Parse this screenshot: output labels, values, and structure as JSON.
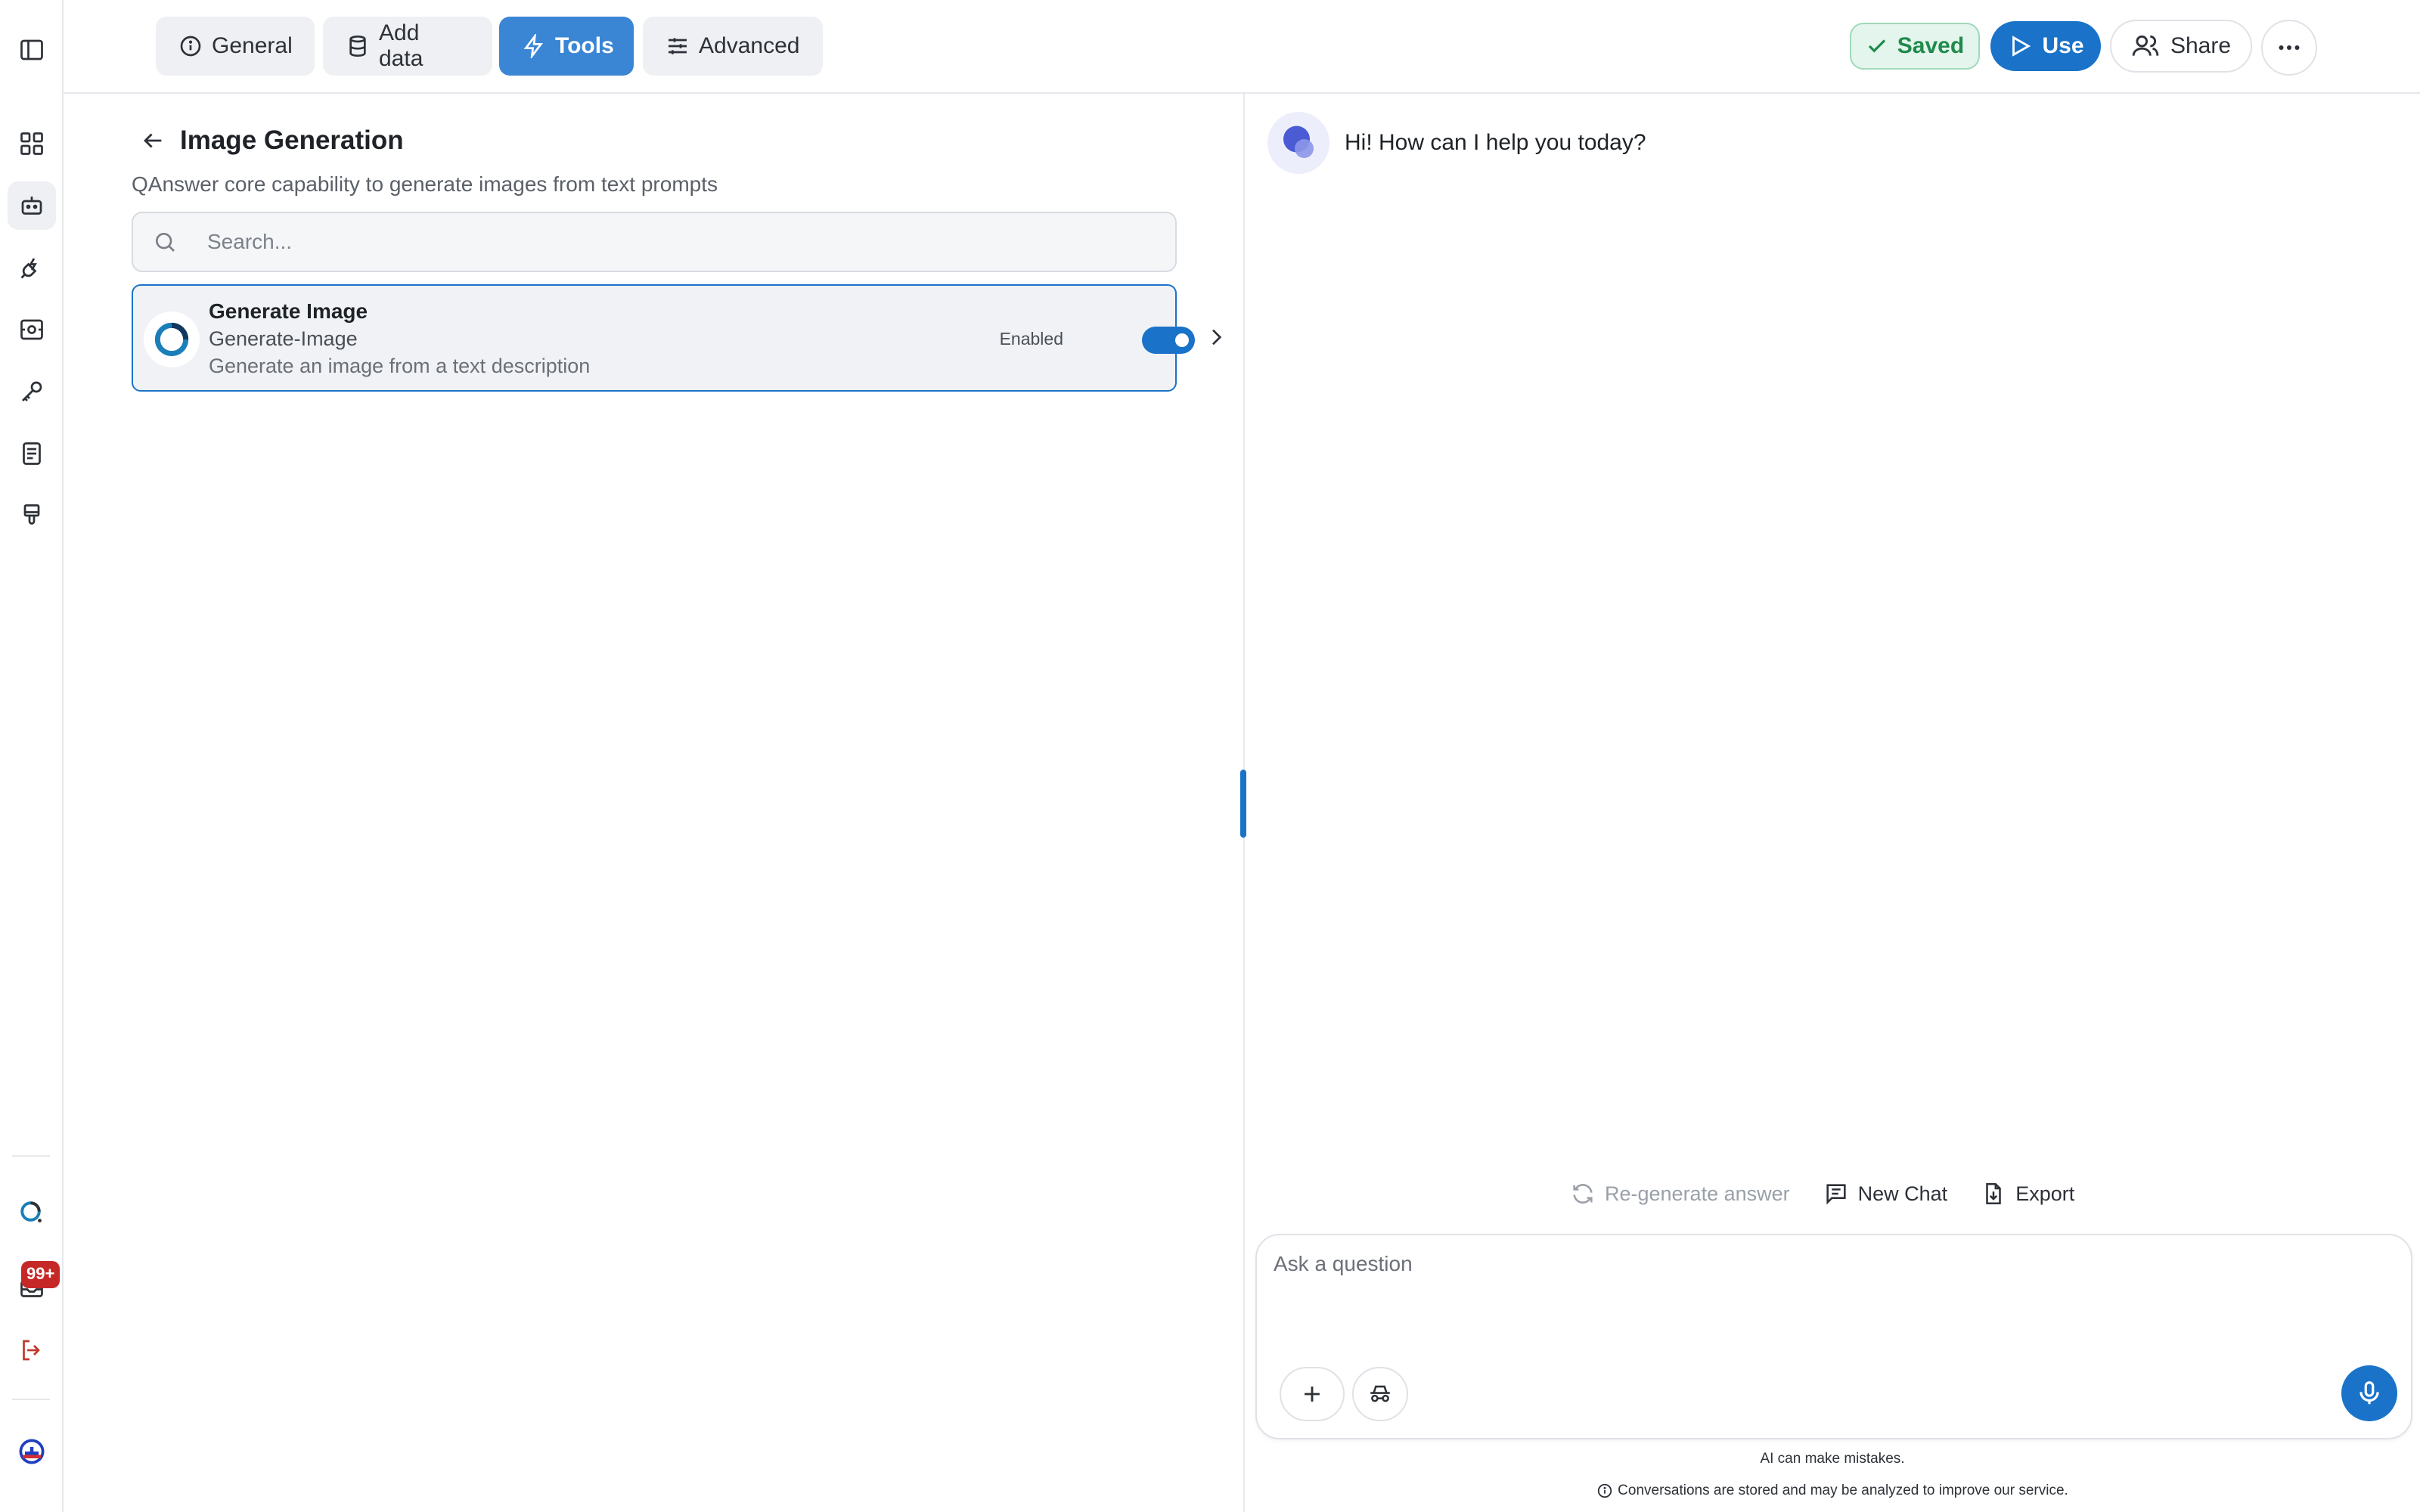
{
  "tabs": [
    {
      "label": "General",
      "icon": "info-icon",
      "active": false
    },
    {
      "label": "Add data",
      "icon": "database-icon",
      "active": false
    },
    {
      "label": "Tools",
      "icon": "bolt-icon",
      "active": true
    },
    {
      "label": "Advanced",
      "icon": "sliders-icon",
      "active": false
    }
  ],
  "header": {
    "saved_label": "Saved",
    "use_label": "Use",
    "share_label": "Share"
  },
  "sidebar": {
    "notification_badge": "99+",
    "items": [
      "panel-toggle-icon",
      "dashboard-icon",
      "bot-icon",
      "plug-icon",
      "scan-icon",
      "key-icon",
      "document-icon",
      "brush-icon",
      "qanswer-logo",
      "inbox-icon",
      "logout-icon",
      "user-avatar"
    ]
  },
  "tools_panel": {
    "title": "Image Generation",
    "subtitle": "QAnswer core capability to generate images from text prompts",
    "search_placeholder": "Search...",
    "tool": {
      "name": "Generate Image",
      "id": "Generate-Image",
      "description": "Generate an image from a text description",
      "status_label": "Enabled",
      "enabled": true
    }
  },
  "chat": {
    "greeting": "Hi! How can I help you today?",
    "actions": {
      "regenerate": "Re-generate answer",
      "new_chat": "New Chat",
      "export": "Export"
    },
    "input_placeholder": "Ask a question",
    "disclaimer": "AI can make mistakes.",
    "privacy_note": "Conversations are stored and may be analyzed to improve our service."
  },
  "colors": {
    "accent": "#1a73c9",
    "tab_active": "#3a86d4",
    "saved_green": "#1f8a4c",
    "badge_red": "#c62828"
  }
}
